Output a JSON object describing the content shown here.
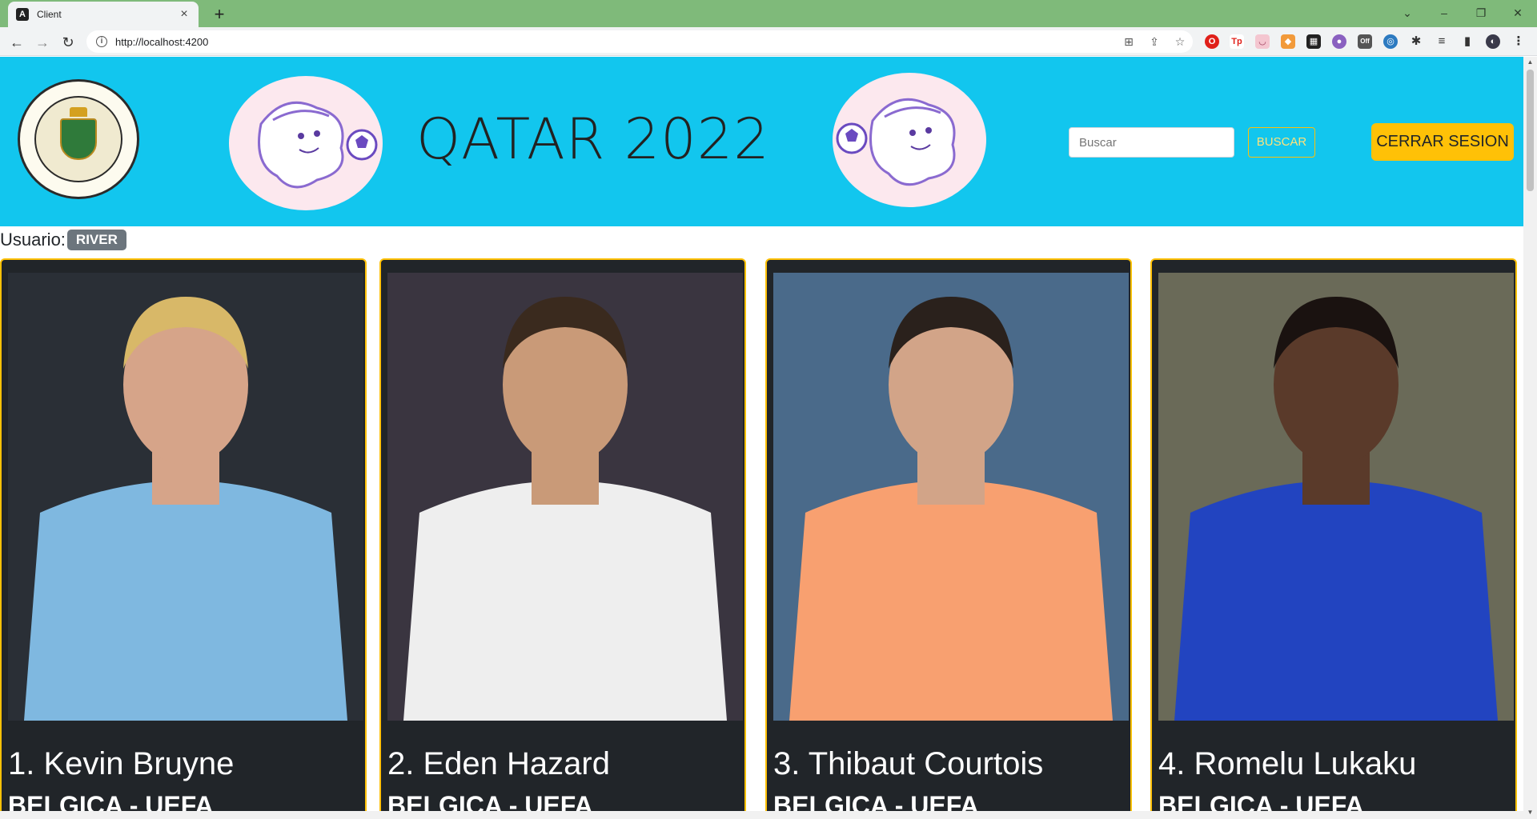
{
  "browser": {
    "tab_title": "Client",
    "tab_favicon": "A",
    "new_tab": "+",
    "url": "http://localhost:4200",
    "window_controls": [
      "⌄",
      "–",
      "❐",
      "✕"
    ]
  },
  "header": {
    "title": "QATAR 2022",
    "search_placeholder": "Buscar",
    "search_button": "BUSCAR",
    "logout_button": "CERRAR SESION"
  },
  "user": {
    "label": "Usuario:",
    "name": "RIVER"
  },
  "players": [
    {
      "name": "1. Kevin Bruyne",
      "team": "BELGICA - UEFA",
      "shirt": "#7fb8e0",
      "bg": "#2a2f36",
      "skin": "#d6a489",
      "hair": "#d8b868"
    },
    {
      "name": "2. Eden Hazard",
      "team": "BELGICA - UEFA",
      "shirt": "#eeeeee",
      "bg": "#3a3540",
      "skin": "#c99a78",
      "hair": "#3a2a1e"
    },
    {
      "name": "3. Thibaut Courtois",
      "team": "BELGICA - UEFA",
      "shirt": "#f8a070",
      "bg": "#4a6a8a",
      "skin": "#d2a488",
      "hair": "#2a211c"
    },
    {
      "name": "4. Romelu Lukaku",
      "team": "BELGICA - UEFA",
      "shirt": "#2244c0",
      "bg": "#6a6a58",
      "skin": "#5a3a2a",
      "hair": "#1a1210"
    }
  ]
}
